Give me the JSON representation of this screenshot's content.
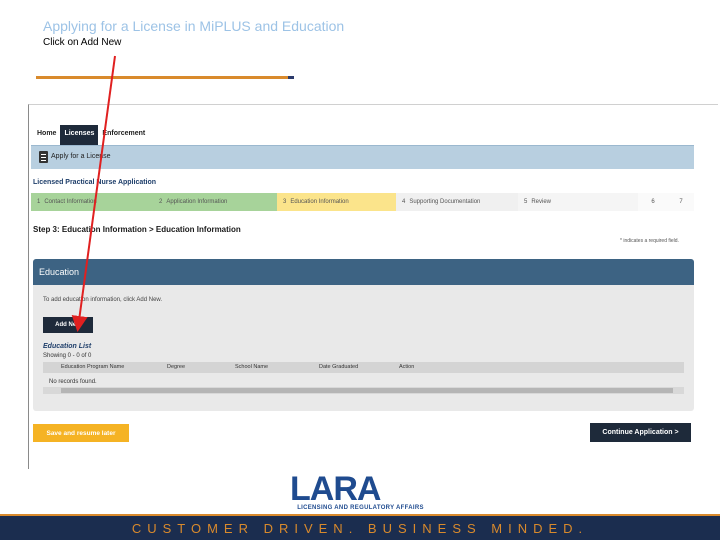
{
  "slide": {
    "title": "Applying for a License in MiPLUS and Education",
    "subtitle": "Click on Add New"
  },
  "nav": {
    "home": "Home",
    "licenses": "Licenses",
    "enforcement": "Enforcement"
  },
  "banner": {
    "label": "Apply for a License"
  },
  "app_title": "Licensed Practical Nurse Application",
  "steps": [
    {
      "num": "1",
      "label": "Contact Information"
    },
    {
      "num": "2",
      "label": "Application Information"
    },
    {
      "num": "3",
      "label": "Education Information"
    },
    {
      "num": "4",
      "label": "Supporting Documentation"
    },
    {
      "num": "5",
      "label": "Review"
    },
    {
      "num": "6",
      "label": ""
    },
    {
      "num": "7",
      "label": ""
    }
  ],
  "step_heading": "Step 3: Education Information > Education Information",
  "required_note": "* indicates a required field.",
  "education": {
    "title": "Education",
    "instructions": "To add education information, click Add New.",
    "add_new": "Add New",
    "list_title": "Education List",
    "showing": "Showing 0 - 0 of 0",
    "columns": [
      "Education Program Name",
      "Degree",
      "School Name",
      "Date Graduated",
      "Action"
    ],
    "no_records": "No records found."
  },
  "buttons": {
    "save": "Save and resume later",
    "continue": "Continue Application >"
  },
  "logo": {
    "text": "LARA",
    "subtext": "LICENSING AND REGULATORY AFFAIRS"
  },
  "footer": {
    "tagline": "CUSTOMER DRIVEN. BUSINESS MINDED."
  },
  "colors": {
    "accent": "#d98a2c",
    "navy": "#1b2d4f",
    "step_done": "#a7d39a",
    "step_current": "#fbe48b",
    "panel_header": "#3d6383",
    "save_button": "#f5b324",
    "arrow": "#e02020"
  }
}
